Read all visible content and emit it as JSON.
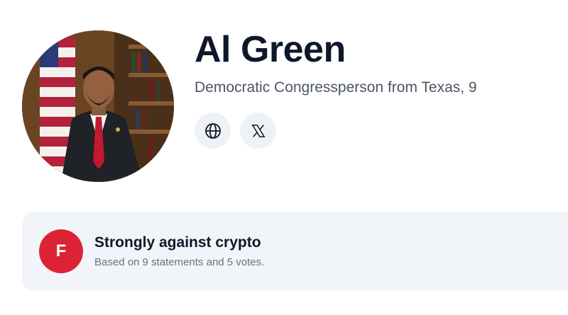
{
  "profile": {
    "name": "Al Green",
    "subtitle": "Democratic Congressperson from Texas, 9",
    "photo_icon": "portrait-photo"
  },
  "social": {
    "website_icon": "globe-icon",
    "x_icon": "x-logo-icon"
  },
  "stance": {
    "grade": "F",
    "title": "Strongly against crypto",
    "summary": "Based on 9 statements and 5 votes.",
    "grade_color": "#dc2335"
  }
}
